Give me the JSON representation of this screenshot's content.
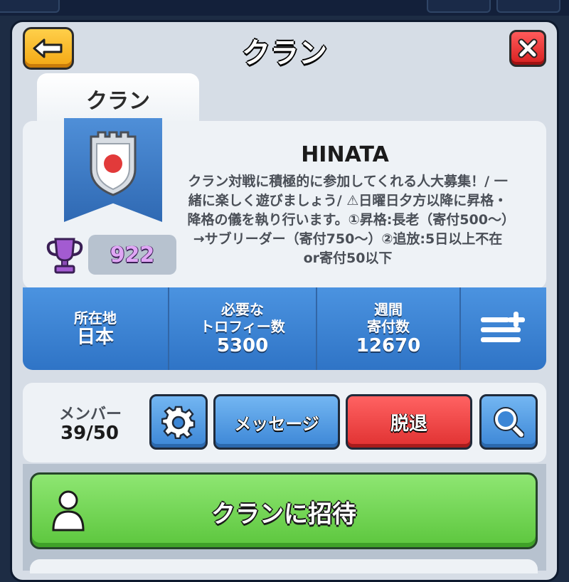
{
  "header": {
    "title": "クラン"
  },
  "tab": {
    "label": "クラン"
  },
  "clan": {
    "name": "HINATA",
    "description": "クラン対戦に積極的に参加してくれる人大募集！/ 一緒に楽しく遊びましょう/ ⚠日曜日夕方以降に昇格・降格の儀を執り行います。①昇格:長老（寄付500～）→サブリーダー（寄付750～）②追放:5日以上不在or寄付50以下",
    "trophies": "922"
  },
  "stats": {
    "location_label": "所在地",
    "location_value": "日本",
    "required_label_1": "必要な",
    "required_label_2": "トロフィー数",
    "required_value": "5300",
    "donations_label_1": "週間",
    "donations_label_2": "寄付数",
    "donations_value": "12670"
  },
  "members": {
    "label": "メンバー",
    "count": "39/50"
  },
  "actions": {
    "message_label": "メッセージ",
    "leave_label": "脱退",
    "invite_label": "クランに招待"
  },
  "icons": {
    "back": "back-arrow-icon",
    "close": "close-icon",
    "settings": "gear-icon",
    "search": "search-icon",
    "filter": "filter-add-icon",
    "trophy": "trophy-icon",
    "avatar": "person-icon"
  },
  "colors": {
    "accent_blue": "#3c86d6",
    "leave_red": "#e03131",
    "invite_green": "#5cc63d",
    "back_yellow": "#f3a712",
    "trophy_purple": "#a35bd1"
  }
}
